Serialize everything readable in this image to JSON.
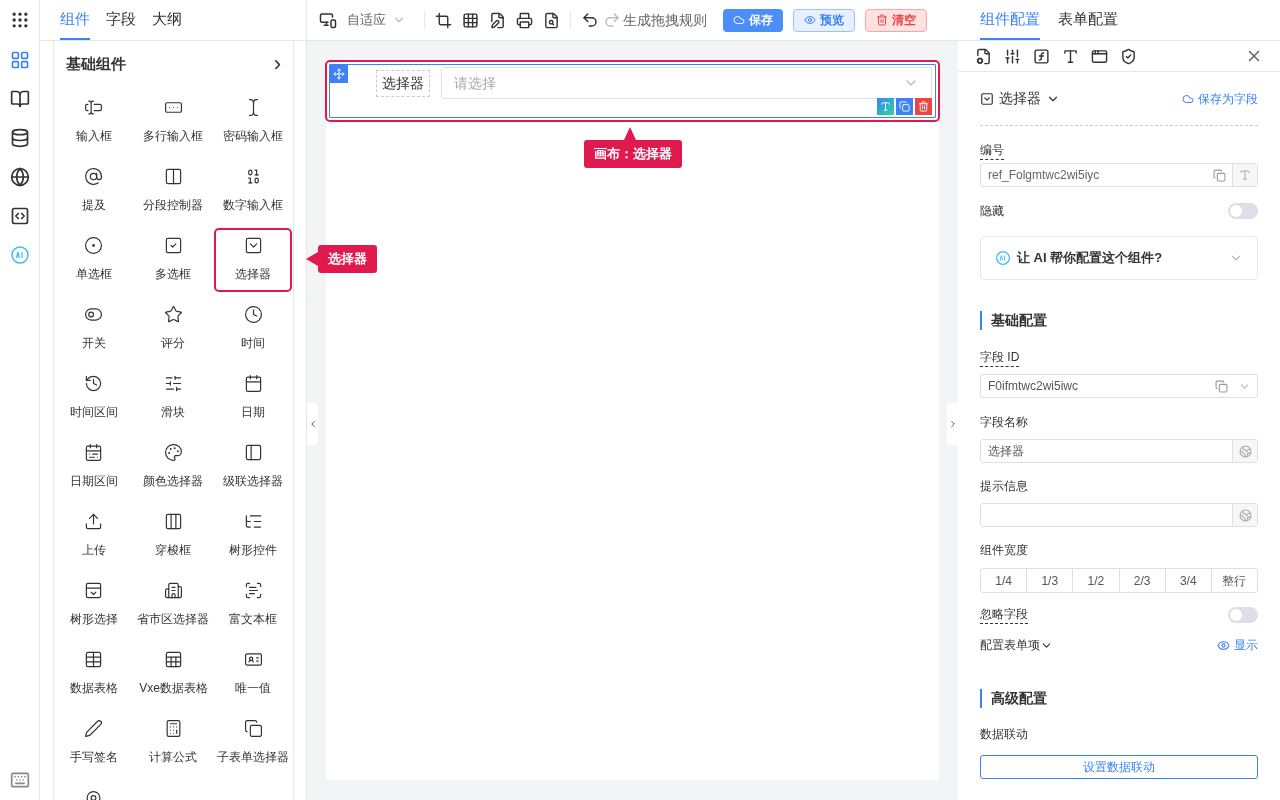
{
  "left_tabs": [
    {
      "label": "组件",
      "selected": true
    },
    {
      "label": "字段",
      "selected": false
    },
    {
      "label": "大纲",
      "selected": false
    }
  ],
  "group": {
    "title": "基础组件",
    "expand": "›"
  },
  "components": [
    {
      "label": "输入框",
      "highlighted": false
    },
    {
      "label": "多行输入框",
      "highlighted": false
    },
    {
      "label": "密码输入框",
      "highlighted": false
    },
    {
      "label": "提及",
      "highlighted": false
    },
    {
      "label": "分段控制器",
      "highlighted": false
    },
    {
      "label": "数字输入框",
      "highlighted": false
    },
    {
      "label": "单选框",
      "highlighted": false
    },
    {
      "label": "多选框",
      "highlighted": false
    },
    {
      "label": "选择器",
      "highlighted": true
    },
    {
      "label": "开关",
      "highlighted": false
    },
    {
      "label": "评分",
      "highlighted": false
    },
    {
      "label": "时间",
      "highlighted": false
    },
    {
      "label": "时间区间",
      "highlighted": false
    },
    {
      "label": "滑块",
      "highlighted": false
    },
    {
      "label": "日期",
      "highlighted": false
    },
    {
      "label": "日期区间",
      "highlighted": false
    },
    {
      "label": "颜色选择器",
      "highlighted": false
    },
    {
      "label": "级联选择器",
      "highlighted": false
    },
    {
      "label": "上传",
      "highlighted": false
    },
    {
      "label": "穿梭框",
      "highlighted": false
    },
    {
      "label": "树形控件",
      "highlighted": false
    },
    {
      "label": "树形选择",
      "highlighted": false
    },
    {
      "label": "省市区选择器",
      "highlighted": false
    },
    {
      "label": "富文本框",
      "highlighted": false
    },
    {
      "label": "数据表格",
      "highlighted": false
    },
    {
      "label": "Vxe数据表格",
      "highlighted": false
    },
    {
      "label": "唯一值",
      "highlighted": false
    },
    {
      "label": "手写签名",
      "highlighted": false
    },
    {
      "label": "计算公式",
      "highlighted": false
    },
    {
      "label": "子表单选择器",
      "highlighted": false
    }
  ],
  "toolbar": {
    "layout": "自适应",
    "redo_label": "生成拖拽规则",
    "save": "保存",
    "preview": "预览",
    "clear": "清空"
  },
  "canvas": {
    "field_label": "选择器",
    "placeholder": "请选择",
    "selected": true
  },
  "callouts": [
    {
      "text": "选择器"
    },
    {
      "text": "画布：选择器"
    }
  ],
  "right_tabs": [
    {
      "label": "组件配置",
      "selected": true
    },
    {
      "label": "表单配置",
      "selected": false
    }
  ],
  "config": {
    "type": "选择器",
    "save_field": "保存为字段",
    "ref_label": "编号",
    "ref_value": "ref_Folgmtwc2wi5iyc",
    "hidden_label": "隐藏",
    "hidden_on": false,
    "ai_prompt": "让 AI 帮你配置这个组件?",
    "basic_title": "基础配置",
    "field_id_label": "字段 ID",
    "field_id_value": "F0ifmtwc2wi5iwc",
    "field_name_label": "字段名称",
    "field_name_value": "选择器",
    "hint_label": "提示信息",
    "width_label": "组件宽度",
    "widths": [
      "1/4",
      "1/3",
      "1/2",
      "2/3",
      "3/4",
      "整行"
    ],
    "ignore_label": "忽略字段",
    "ignore_on": false,
    "form_item_label": "配置表单项",
    "show_label": "显示",
    "advanced_title": "高级配置",
    "linkage_label": "数据联动",
    "linkage_button": "设置数据联动"
  }
}
